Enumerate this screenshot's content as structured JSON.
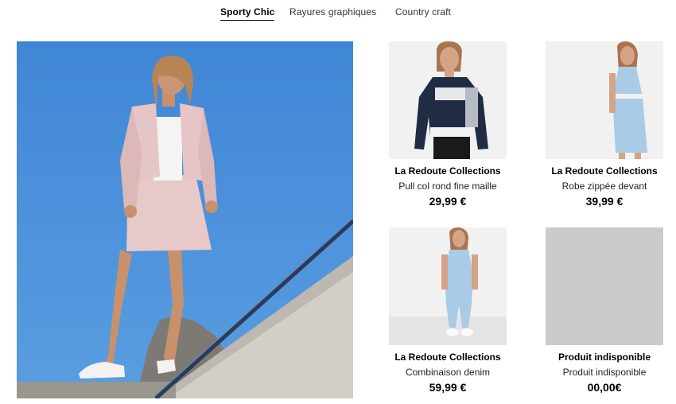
{
  "tabs": [
    {
      "label": "Sporty Chic",
      "active": true
    },
    {
      "label": "Rayures graphiques",
      "active": false
    },
    {
      "label": "Country craft",
      "active": false
    }
  ],
  "products": [
    {
      "brand": "La Redoute Collections",
      "name": "Pull col rond fine maille",
      "price": "29,99 €"
    },
    {
      "brand": "La Redoute Collections",
      "name": "Robe zippée devant",
      "price": "39,99 €"
    },
    {
      "brand": "La Redoute Collections",
      "name": "Combinaison denim",
      "price": "59,99 €"
    },
    {
      "brand": "Produit indisponible",
      "name": "Produit indisponible",
      "price": "00,00€"
    }
  ],
  "colors": {
    "sky": "#4a90d9",
    "unavailable_placeholder": "#cbcbcb",
    "active_tab_underline": "#000000"
  }
}
